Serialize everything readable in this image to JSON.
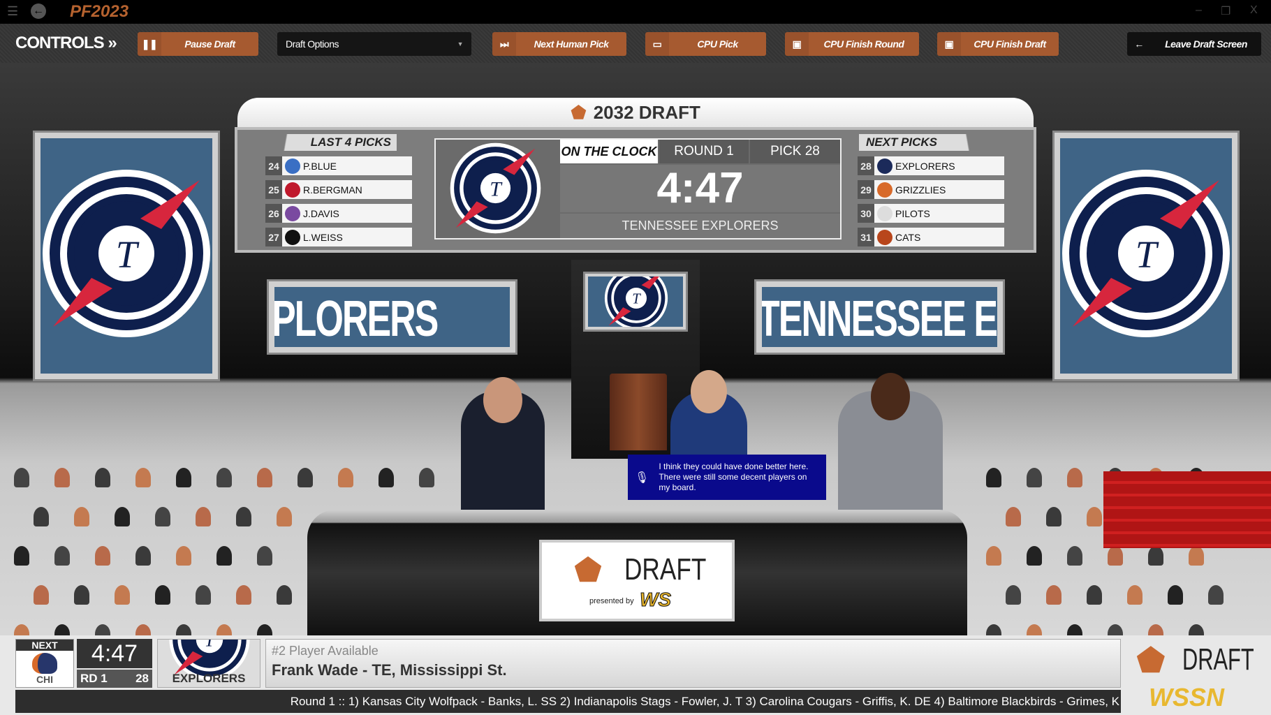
{
  "app": {
    "logo_text": "PF2023",
    "window_controls": [
      "–",
      "❐",
      "X"
    ]
  },
  "controls": {
    "label": "CONTROLS",
    "pause": "Pause Draft",
    "draft_options": "Draft Options",
    "next_human": "Next Human Pick",
    "cpu_pick": "CPU Pick",
    "cpu_finish_round": "CPU Finish Round",
    "cpu_finish_draft": "CPU Finish Draft",
    "leave": "Leave Draft Screen"
  },
  "board": {
    "title": "2032 DRAFT",
    "last_picks_label": "LAST 4 PICKS",
    "last_picks": [
      {
        "n": "24",
        "name": "P.BLUE",
        "color": "#3a6fc4"
      },
      {
        "n": "25",
        "name": "R.BERGMAN",
        "color": "#c0192c"
      },
      {
        "n": "26",
        "name": "J.DAVIS",
        "color": "#7a4aa0"
      },
      {
        "n": "27",
        "name": "L.WEISS",
        "color": "#111111"
      }
    ],
    "on_the_clock": "ON THE CLOCK",
    "round": "ROUND 1",
    "pick": "PICK 28",
    "timer": "4:47",
    "team": "TENNESSEE EXPLORERS",
    "next_picks_label": "NEXT PICKS",
    "next_picks": [
      {
        "n": "28",
        "name": "EXPLORERS",
        "color": "#1b2a5a"
      },
      {
        "n": "29",
        "name": "GRIZZLIES",
        "color": "#d86a2a"
      },
      {
        "n": "30",
        "name": "PILOTS",
        "color": "#dddddd"
      },
      {
        "n": "31",
        "name": "CATS",
        "color": "#b8461c"
      }
    ]
  },
  "banners": {
    "left": "PLORERS",
    "right": "TENNESSEE EXPI"
  },
  "speech": "I think they could have done better here. There were still some decent players on my board.",
  "desk": {
    "draft": "DRAFT",
    "presented_by": "presented by",
    "sponsor": "WS"
  },
  "ticker_bar": {
    "next_label": "NEXT",
    "next_team": "CHI",
    "timer": "4:47",
    "round": "RD 1",
    "pick": "28",
    "team": "EXPLORERS",
    "player_label": "#2 Player Available",
    "player": "Frank Wade - TE, Mississippi St.",
    "ticker": "Round 1 :: 1) Kansas City Wolfpack - Banks, L. SS 2) Indianapolis Stags - Fowler, J. T 3) Carolina Cougars - Griffis, K. DE 4) Baltimore Blackbirds - Grimes, K",
    "logo_draft": "DRAFT",
    "logo_network": "WSSN"
  },
  "colors": {
    "accent": "#a65a30",
    "navy": "#0e1f4d",
    "red": "#d7263d",
    "speech_bg": "#0a0a8c"
  }
}
